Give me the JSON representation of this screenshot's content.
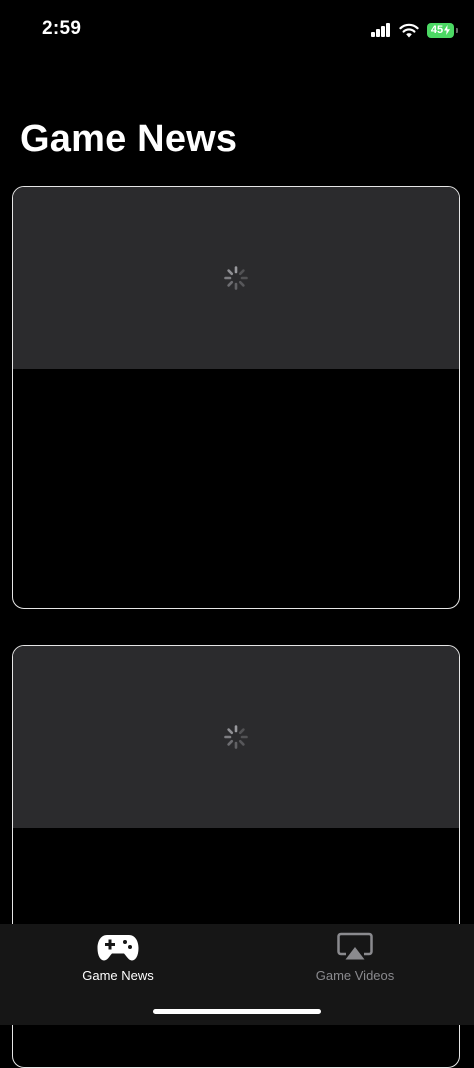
{
  "status_bar": {
    "time": "2:59",
    "battery_level": "45",
    "battery_color": "#4cd964"
  },
  "header": {
    "title": "Game News"
  },
  "cards": [
    {
      "image_state": "loading",
      "spinner_icon": "activity-spinner-icon"
    },
    {
      "image_state": "loading",
      "spinner_icon": "activity-spinner-icon"
    }
  ],
  "tab_bar": {
    "items": [
      {
        "label": "Game News",
        "icon": "gamecontroller-icon",
        "selected": true
      },
      {
        "label": "Game Videos",
        "icon": "airplay-video-icon",
        "selected": false
      }
    ],
    "active_color": "#ffffff",
    "inactive_color": "#8a8a8e"
  }
}
